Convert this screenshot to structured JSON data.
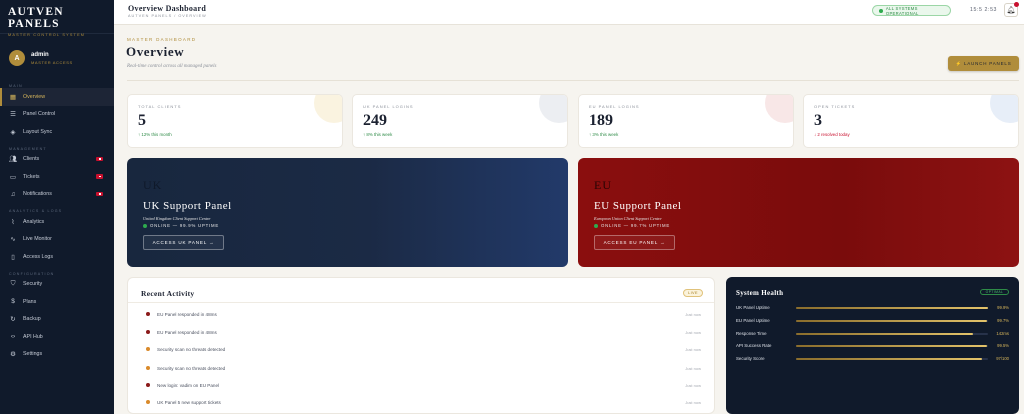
{
  "brand": {
    "title": "AUTVEN PANELS",
    "subtitle": "MASTER CONTROL SYSTEM"
  },
  "user": {
    "initial": "A",
    "name": "admin",
    "role": "MASTER ACCESS"
  },
  "sidebar": {
    "sections": [
      {
        "label": "MAIN",
        "items": [
          {
            "label": "Overview",
            "icon": "grid-icon",
            "active": true
          },
          {
            "label": "Panel Control",
            "icon": "sliders-icon"
          },
          {
            "label": "Layout Sync",
            "icon": "layers-icon"
          }
        ]
      },
      {
        "label": "MANAGEMENT",
        "items": [
          {
            "label": "Clients",
            "icon": "users-icon",
            "badge": true
          },
          {
            "label": "Tickets",
            "icon": "ticket-icon",
            "badge": true
          },
          {
            "label": "Notifications",
            "icon": "bell-icon",
            "badge": true
          }
        ]
      },
      {
        "label": "ANALYTICS & LOGS",
        "items": [
          {
            "label": "Analytics",
            "icon": "chart-icon"
          },
          {
            "label": "Live Monitor",
            "icon": "activity-icon"
          },
          {
            "label": "Access Logs",
            "icon": "file-icon"
          }
        ]
      },
      {
        "label": "CONFIGURATION",
        "items": [
          {
            "label": "Security",
            "icon": "shield-icon"
          },
          {
            "label": "Plans",
            "icon": "dollar-icon"
          },
          {
            "label": "Backup",
            "icon": "refresh-icon"
          },
          {
            "label": "API Hub",
            "icon": "code-icon"
          },
          {
            "label": "Settings",
            "icon": "gear-icon"
          }
        ]
      }
    ]
  },
  "topbar": {
    "title": "Overview Dashboard",
    "breadcrumb": "AUTVEN PANELS / OVERVIEW",
    "status": "ALL SYSTEMS OPERATIONAL",
    "time": "15:5 2:53"
  },
  "page": {
    "eyebrow": "MASTER DASHBOARD",
    "title": "Overview",
    "subtitle": "Real-time control across all managed panels",
    "launch_label": "⚡ LAUNCH PANELS"
  },
  "stats": [
    {
      "label": "TOTAL CLIENTS",
      "value": "5",
      "trend": "↑ 12% this month",
      "dir": "up",
      "circle": "#faf3e0"
    },
    {
      "label": "UK PANEL LOGINS",
      "value": "249",
      "trend": "↑ 8% this week",
      "dir": "up",
      "circle": "#eceef2"
    },
    {
      "label": "EU PANEL LOGINS",
      "value": "189",
      "trend": "↑ 3% this week",
      "dir": "up",
      "circle": "#f8e7e7"
    },
    {
      "label": "OPEN TICKETS",
      "value": "3",
      "trend": "↓ 2 resolved today",
      "dir": "down",
      "circle": "#e7eef8"
    }
  ],
  "panels": {
    "uk": {
      "code": "UK",
      "title": "UK Support Panel",
      "subtitle": "United Kingdom Client Support Centre",
      "status": "ONLINE — 99.9% UPTIME",
      "button": "ACCESS UK PANEL →"
    },
    "eu": {
      "code": "EU",
      "title": "EU Support Panel",
      "subtitle": "European Union Client Support Centre",
      "status": "ONLINE — 99.7% UPTIME",
      "button": "ACCESS EU PANEL →"
    }
  },
  "activity": {
    "title": "Recent Activity",
    "live": "LIVE",
    "items": [
      {
        "text": "EU Panel responded in 48ms",
        "time": "Just now",
        "color": "#8b1a1a"
      },
      {
        "text": "EU Panel responded in 48ms",
        "time": "Just now",
        "color": "#8b1a1a"
      },
      {
        "text": "Security scan no threats detected",
        "time": "Just now",
        "color": "#d98a2b"
      },
      {
        "text": "Security scan no threats detected",
        "time": "Just now",
        "color": "#d98a2b"
      },
      {
        "text": "New login: vadim on EU Panel",
        "time": "Just now",
        "color": "#8b1a1a"
      },
      {
        "text": "UK Panel 5 new support tickets",
        "time": "Just now",
        "color": "#d98a2b"
      }
    ]
  },
  "health": {
    "title": "System Health",
    "badge": "OPTIMAL",
    "metrics": [
      {
        "label": "UK Panel Uptime",
        "value": "99.9%",
        "level": 0.999
      },
      {
        "label": "EU Panel Uptime",
        "value": "99.7%",
        "level": 0.997
      },
      {
        "label": "Response Time",
        "value": "142ms",
        "level": 0.92
      },
      {
        "label": "API Success Rate",
        "value": "99.5%",
        "level": 0.995
      },
      {
        "label": "Security Score",
        "value": "97/100",
        "level": 0.97
      }
    ]
  }
}
